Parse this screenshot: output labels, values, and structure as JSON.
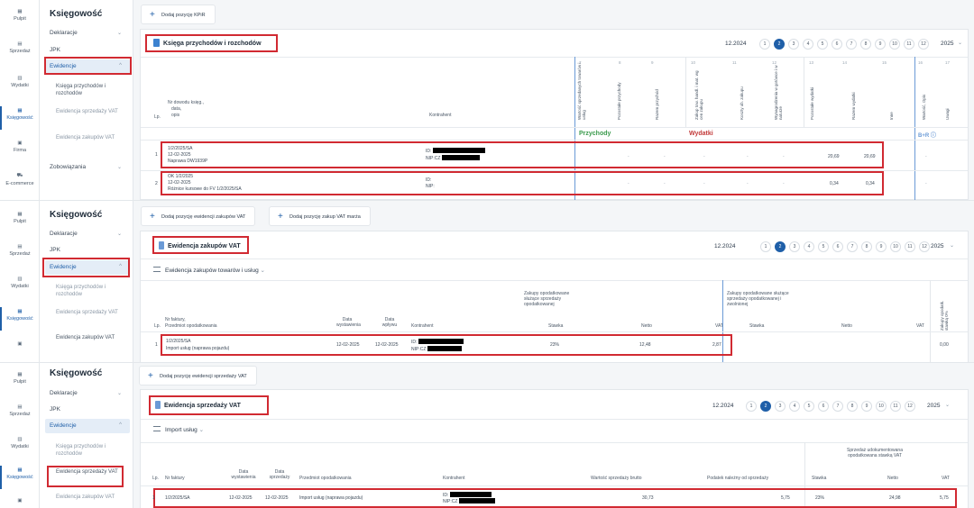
{
  "nav": {
    "pulpit": "Pulpit",
    "sprzedaz": "Sprzedaż",
    "wydatki": "Wydatki",
    "ksiegowosc": "Księgowość",
    "firma": "Firma",
    "ecommerce": "E-commerce"
  },
  "menu": {
    "title": "Księgowość",
    "deklaracje": "Deklaracje",
    "jpk": "JPK",
    "ewidencje": "Ewidencje",
    "kpir": "Księga przychodów i rozchodów",
    "ev_sprzedazy": "Ewidencja sprzedaży VAT",
    "ev_zakupow": "Ewidencja zakupów VAT",
    "zobowiazania": "Zobowiązania"
  },
  "pagination": {
    "month": "12.2024",
    "pages": [
      "1",
      "2",
      "3",
      "4",
      "5",
      "6",
      "7",
      "8",
      "9",
      "10",
      "11",
      "12"
    ],
    "current": "2",
    "year": "2025"
  },
  "kpir": {
    "add_button": "Dodaj pozycję KPiR",
    "title": "Księga przychodów i rozchodów",
    "col_nums": [
      "7",
      "8",
      "9",
      "10",
      "11",
      "12",
      "13",
      "14",
      "15",
      "16",
      "17"
    ],
    "headers": {
      "lp": "Lp.",
      "nr": "Nr dowodu księg.,",
      "data": "data,",
      "opis": "opis",
      "kontrahent": "Kontrahent",
      "wartosc_sprzedanych": "Wartość sprzedanych towarów i usług",
      "pozostale_przychody": "Pozostałe przychody",
      "razem_przychod": "Razem przychód",
      "zakup_towarow": "Zakup tow. handl. i mat. wg cen zakupu",
      "koszty_ub": "Koszty ub. zakupu",
      "wynagrodzenia": "Wynagrodzenia w gotówce i w naturze",
      "pozostale_wydatki": "Pozostałe wydatki",
      "razem_wydatki": "Razem wydatki",
      "inne": "Inne",
      "wartosc_opis": "Wartość, Opis",
      "uwagi": "Uwagi"
    },
    "sections": {
      "przychody": "Przychody",
      "wydatki": "Wydatki",
      "br": "B+R ⓘ"
    },
    "rows": [
      {
        "lp": "1",
        "nr": "1/2/2025/SA",
        "data": "12-02-2025",
        "opis": "Naprawa DW1939P",
        "id_label": "ID:",
        "nip_label": "NIP:CZ",
        "dash": "-",
        "pozostale": "20,69",
        "razem": "20,69"
      },
      {
        "lp": "2",
        "nr": "OK 1/2/2025",
        "data": "12-02-2025",
        "opis": "Różnice kursowe do FV 1/2/2025/SA",
        "id_label": "ID:",
        "nip_label": "NIP:",
        "dash": "-",
        "pozostale": "0,34",
        "razem": "0,34"
      }
    ]
  },
  "zakupy": {
    "add_button": "Dodaj pozycję ewidencji zakupów VAT",
    "add_button2": "Dodaj pozycję zakup VAT marża",
    "title": "Ewidencja zakupów VAT",
    "subtitle": "Ewidencja zakupów towarów i usług",
    "headers": {
      "lp": "Lp.",
      "nr": "Nr faktury,",
      "przedmiot": "Przedmiot opodatkowania",
      "data_wyst": "Data wystawienia",
      "data_wpl": "Data wpływu",
      "kontrahent": "Kontrahent",
      "group1": "Zakupy opodatkowane służące sprzedaży opodatkowanej",
      "group2": "Zakupy opodatkowane służące sprzedaży opodatkowanej i zwolnionej",
      "stawka": "Stawka",
      "netto": "Netto",
      "vat": "VAT",
      "zakupy0": "Zakupy opodatk. stawką 0%"
    },
    "rows": [
      {
        "lp": "1",
        "nr": "1/2/2025/SA",
        "przedmiot": "Import usług (naprawa pojazdu)",
        "data_wyst": "12-02-2025",
        "data_wpl": "12-02-2025",
        "id_label": "ID:",
        "nip_label": "NIP:CZ",
        "stawka": "23%",
        "netto": "12,48",
        "vat": "2,87",
        "zero": "0,00"
      }
    ]
  },
  "sprzedaz": {
    "add_button": "Dodaj pozycję ewidencji sprzedaży VAT",
    "title": "Ewidencja sprzedaży VAT",
    "subtitle": "Import usług",
    "headers": {
      "lp": "Lp.",
      "nr": "Nr faktury",
      "data_wyst": "Data wystawienia",
      "data_sprz": "Data sprzedaży",
      "przedmiot": "Przedmiot opodatkowania",
      "kontrahent": "Kontrahent",
      "wartosc_brutto": "Wartość sprzedaży brutto",
      "podatek": "Podatek należny od sprzedaży",
      "group": "Sprzedaż udokumentowana opodatkowana stawką VAT",
      "stawka": "Stawka",
      "netto": "Netto",
      "vat": "VAT"
    },
    "rows": [
      {
        "lp": "1",
        "nr": "1/2/2025/SA",
        "data_wyst": "12-02-2025",
        "data_sprz": "12-02-2025",
        "przedmiot": "Import usług (naprawa pojazdu)",
        "id_label": "ID:",
        "nip_label": "NIP:CZ",
        "brutto": "30,73",
        "podatek": "5,75",
        "stawka": "23%",
        "netto": "24,98",
        "vat": "5,75"
      }
    ]
  },
  "colors": {
    "accent": "#1f5fa8",
    "highlight": "#d12a32",
    "income": "#3a9a4c",
    "expense": "#c23a3a"
  }
}
